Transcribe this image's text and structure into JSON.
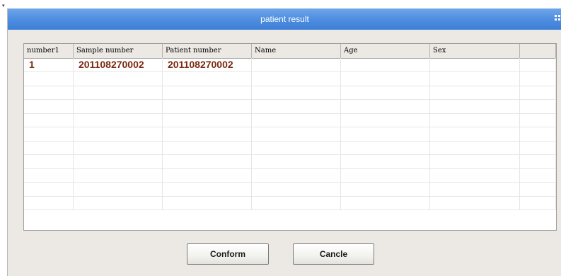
{
  "window": {
    "title": "patient result"
  },
  "table": {
    "columns": [
      "number1",
      "Sample number",
      "Patient number",
      "Name",
      "Age",
      "Sex",
      ""
    ],
    "rows": [
      [
        "1",
        "201108270002",
        "201108270002",
        "",
        "",
        "",
        ""
      ]
    ],
    "empty_row_count": 10
  },
  "buttons": {
    "confirm_label": "Conform",
    "cancel_label": "Cancle"
  }
}
